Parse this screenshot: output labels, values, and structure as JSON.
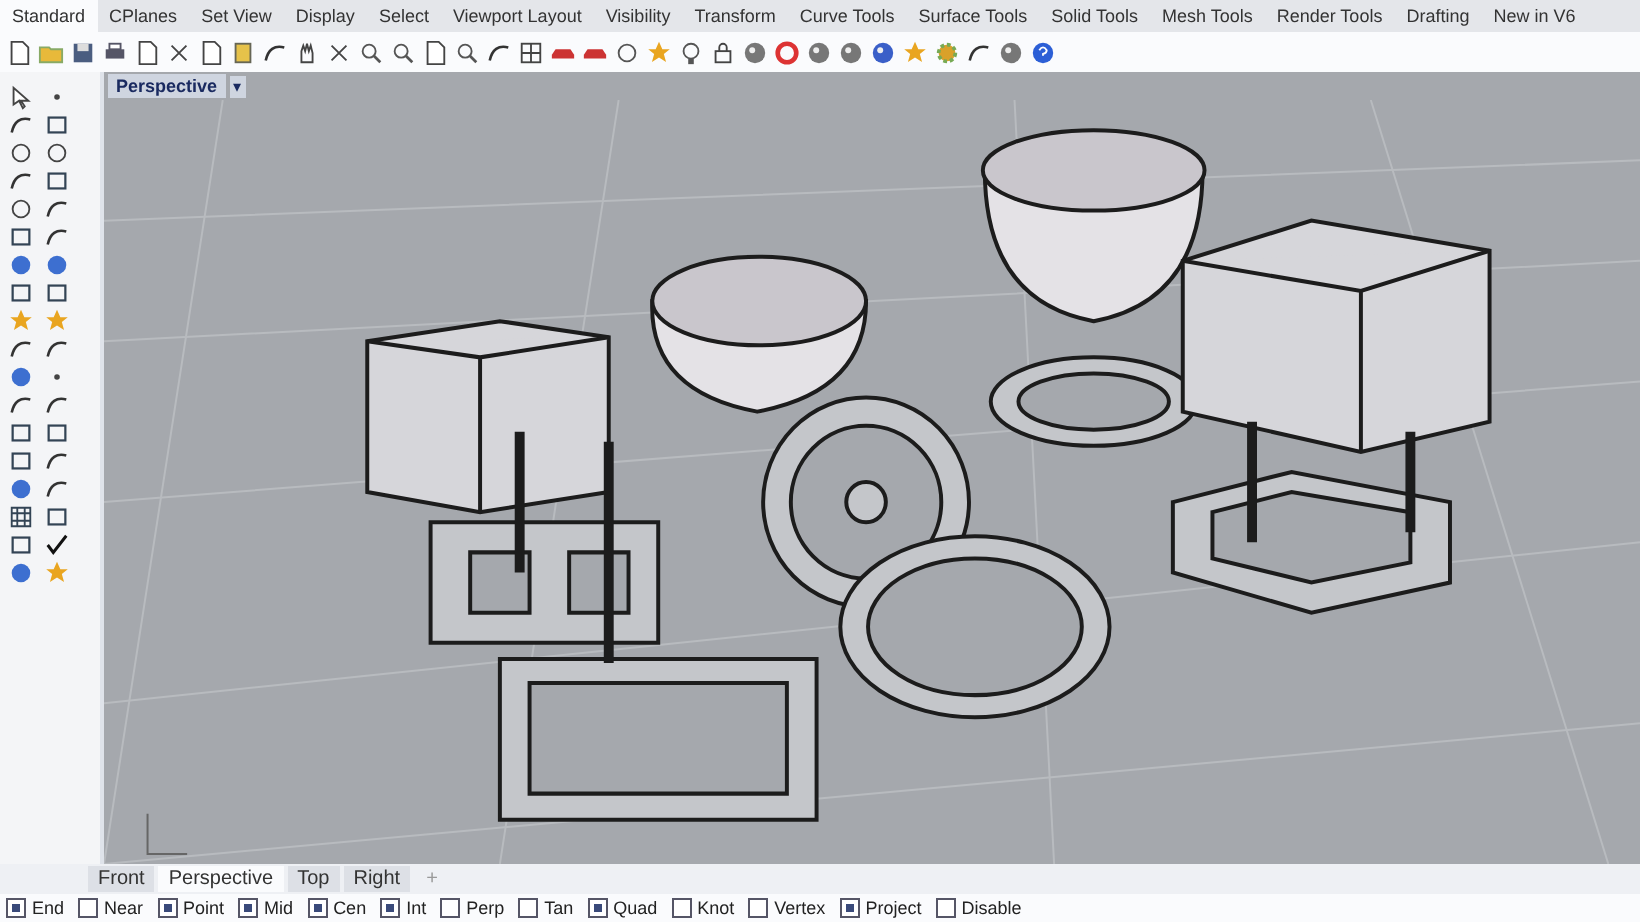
{
  "menu_tabs": [
    {
      "label": "Standard",
      "selected": true
    },
    {
      "label": "CPlanes",
      "selected": false
    },
    {
      "label": "Set View",
      "selected": false
    },
    {
      "label": "Display",
      "selected": false
    },
    {
      "label": "Select",
      "selected": false
    },
    {
      "label": "Viewport Layout",
      "selected": false
    },
    {
      "label": "Visibility",
      "selected": false
    },
    {
      "label": "Transform",
      "selected": false
    },
    {
      "label": "Curve Tools",
      "selected": false
    },
    {
      "label": "Surface Tools",
      "selected": false
    },
    {
      "label": "Solid Tools",
      "selected": false
    },
    {
      "label": "Mesh Tools",
      "selected": false
    },
    {
      "label": "Render Tools",
      "selected": false
    },
    {
      "label": "Drafting",
      "selected": false
    },
    {
      "label": "New in V6",
      "selected": false
    }
  ],
  "viewport": {
    "title": "Perspective",
    "menu_glyph": "▾"
  },
  "view_tabs": [
    {
      "label": "Front",
      "selected": false
    },
    {
      "label": "Perspective",
      "selected": true
    },
    {
      "label": "Top",
      "selected": false
    },
    {
      "label": "Right",
      "selected": false
    }
  ],
  "add_view_glyph": "+",
  "osnaps": [
    {
      "label": "End",
      "checked": true
    },
    {
      "label": "Near",
      "checked": false
    },
    {
      "label": "Point",
      "checked": true
    },
    {
      "label": "Mid",
      "checked": true
    },
    {
      "label": "Cen",
      "checked": true
    },
    {
      "label": "Int",
      "checked": true
    },
    {
      "label": "Perp",
      "checked": false
    },
    {
      "label": "Tan",
      "checked": false
    },
    {
      "label": "Quad",
      "checked": true
    },
    {
      "label": "Knot",
      "checked": false
    },
    {
      "label": "Vertex",
      "checked": false
    },
    {
      "label": "Project",
      "checked": true
    },
    {
      "label": "Disable",
      "checked": false
    }
  ]
}
